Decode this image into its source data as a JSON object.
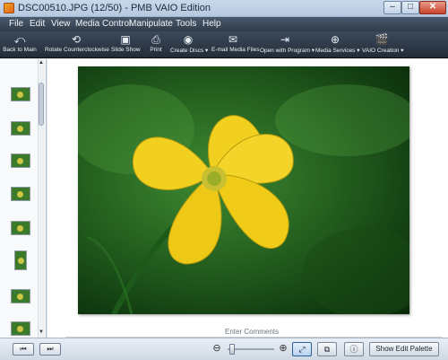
{
  "window": {
    "title": "DSC00510.JPG (12/50)  -  PMB VAIO Edition",
    "minimize_glyph": "–",
    "maximize_glyph": "□",
    "close_glyph": "✕"
  },
  "menu": [
    "File",
    "Edit",
    "View",
    "Media Control",
    "Manipulate",
    "Tools",
    "Help"
  ],
  "toolbar": [
    {
      "label": "Back to Main",
      "icon": "back-arrow-icon",
      "glyph": "⤺"
    },
    {
      "label": "Rotate Counterclockwise",
      "icon": "rotate-icon",
      "glyph": "⟲"
    },
    {
      "label": "Slide Show",
      "icon": "slideshow-icon",
      "glyph": "▣"
    },
    {
      "label": "Print",
      "icon": "printer-icon",
      "glyph": "⎙"
    },
    {
      "label": "Create Discs ▾",
      "icon": "disc-icon",
      "glyph": "◉"
    },
    {
      "label": "E-mail Media Files",
      "icon": "envelope-icon",
      "glyph": "✉"
    },
    {
      "label": "Open with Program ▾",
      "icon": "open-program-icon",
      "glyph": "⇥"
    },
    {
      "label": "Media Services ▾",
      "icon": "globe-icon",
      "glyph": "⊕"
    },
    {
      "label": "VAIO Creation ▾",
      "icon": "clapperboard-icon",
      "glyph": "🎬"
    }
  ],
  "filmstrip": {
    "scroll_up_glyph": "▲",
    "scroll_down_glyph": "▼"
  },
  "viewer": {
    "comments_placeholder": "Enter Comments"
  },
  "bottombar": {
    "prev_glyph": "⏮",
    "next_glyph": "⏭",
    "zoom_out_glyph": "⊖",
    "zoom_in_glyph": "⊕",
    "fit_glyph": "⤢",
    "compare_glyph": "⧉",
    "info_glyph": "ⓘ",
    "show_edit_palette": "Show Edit Palette"
  },
  "colors": {
    "toolbar_dark": "#2f3b4a",
    "flower_yellow": "#f2d020",
    "leaf_green": "#245f1e"
  }
}
